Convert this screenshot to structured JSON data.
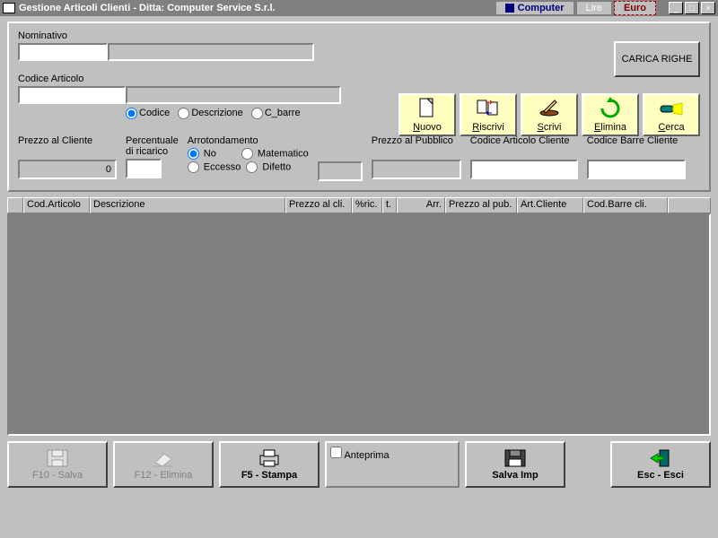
{
  "titlebar": {
    "title": "Gestione Articoli Clienti - Ditta: Computer Service S.r.l.",
    "tabs": {
      "computer": "Computer",
      "lire": "Lire",
      "euro": "Euro"
    },
    "winbtns": {
      "min": "_",
      "max": "□",
      "close": "×"
    }
  },
  "top": {
    "nominativo_label": "Nominativo",
    "nominativo_code": "",
    "nominativo_name": "",
    "carica_righe": "CARICA RIGHE",
    "codice_articolo_label": "Codice Articolo",
    "codice_articolo_code": "",
    "codice_articolo_desc": "",
    "radio": {
      "codice": "Codice",
      "descrizione": "Descrizione",
      "cbarre": "C_barre"
    }
  },
  "toolbar": {
    "nuovo": "Nuovo",
    "riscrivi": "Riscrivi",
    "scrivi": "Scrivi",
    "elimina": "Elimina",
    "cerca": "Cerca"
  },
  "mid": {
    "prezzo_cliente_label": "Prezzo al Cliente",
    "prezzo_cliente_value": "0",
    "percentuale_label": "Percentuale\ndi ricarico",
    "percentuale_value": "",
    "arrot_label": "Arrotondamento",
    "arrot": {
      "no": "No",
      "matematico": "Matematico",
      "eccesso": "Eccesso",
      "difetto": "Difetto"
    },
    "prezzo_pubblico_label": "Prezzo al Pubblico",
    "prezzo_pubblico_value": "",
    "cod_art_cliente_label": "Codice Articolo Cliente",
    "cod_art_cliente_value": "",
    "cod_barre_cliente_label": "Codice Barre Cliente",
    "cod_barre_cliente_value": ""
  },
  "grid": {
    "headers": {
      "rowhead": "",
      "cod_articolo": "Cod.Articolo",
      "descrizione": "Descrizione",
      "prezzo_cli": "Prezzo al cli.",
      "perc_ric": "%ric.",
      "t": "t.",
      "arr": "Arr.",
      "prezzo_pub": "Prezzo al pub.",
      "art_cliente": "Art.Cliente",
      "cod_barre_cli": "Cod.Barre cli."
    }
  },
  "bottom": {
    "f10_salva": "F10 - Salva",
    "f12_elimina": "F12 - Elimina",
    "f5_stampa": "F5 - Stampa",
    "anteprima": "Anteprima",
    "salva_imp": "Salva Imp",
    "esc_esci": "Esc - Esci"
  }
}
